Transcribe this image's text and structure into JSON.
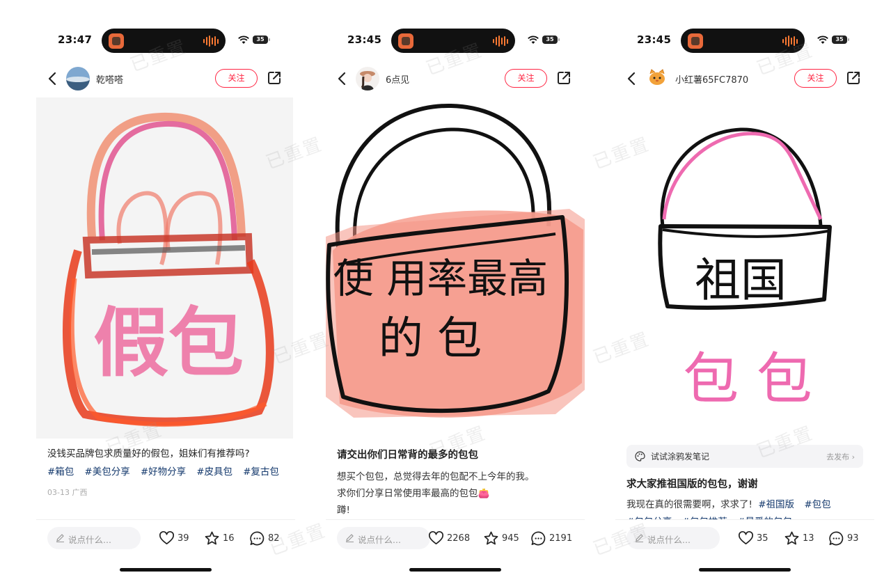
{
  "watermark_text": "已重置",
  "phones": [
    {
      "time": "23:47",
      "battery": "35",
      "username": "乾嗒嗒",
      "follow_label": "关注",
      "image_text": "假包",
      "caption": "没钱买品牌包求质量好的假包，姐妹们有推荐吗?",
      "tags": [
        "#箱包",
        "#美包分享",
        "#好物分享",
        "#皮具包",
        "#复古包"
      ],
      "meta": "03-13 广西",
      "comment_placeholder": "说点什么...",
      "likes": "39",
      "collects": "16",
      "comments": "82"
    },
    {
      "time": "23:45",
      "battery": "35",
      "username": "6点见",
      "follow_label": "关注",
      "image_text_line1": "使 用率最高",
      "image_text_line2": "的 包",
      "title": "请交出你们日常背的最多的包包",
      "body_line1": "想买个包包，总觉得去年的包配不上今年的我。",
      "body_line2": "求你们分享日常使用率最高的包包👛",
      "body_line3": "蹲!",
      "comment_placeholder": "说点什么...",
      "likes": "2268",
      "collects": "945",
      "comments": "2191"
    },
    {
      "time": "23:45",
      "battery": "35",
      "username": "小红薯65FC7870",
      "follow_label": "关注",
      "image_text_line1": "祖国",
      "image_text_line2": "包 包",
      "doodle_label": "试试涂鸦发笔记",
      "doodle_action": "去发布",
      "title": "求大家推祖国版的包包，谢谢",
      "body_line1": "我现在真的很需要啊，求求了!",
      "body_tags": [
        "#祖国版",
        "#包包"
      ],
      "body_line2_tags": [
        "#包包分享",
        "#包包推荐",
        "#最爱的包包"
      ],
      "comment_placeholder": "说点什么...",
      "likes": "35",
      "collects": "13",
      "comments": "93"
    }
  ]
}
